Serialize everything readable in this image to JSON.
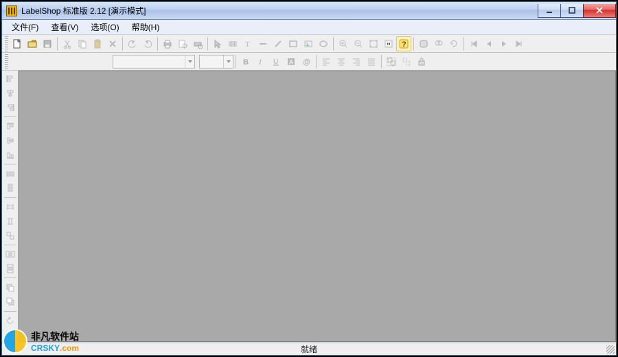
{
  "title": "LabelShop 标准版 2.12 [演示模式]",
  "menu": {
    "file": "文件(F)",
    "view": "查看(V)",
    "options": "选项(O)",
    "help": "帮助(H)"
  },
  "status": "就绪",
  "toolbar2": {
    "font_name": "",
    "font_size": ""
  },
  "watermark": {
    "line1": "非凡软件站",
    "line2_a": "CRSKY",
    "line2_b": ".com"
  },
  "icons": {
    "new": "new-file-icon",
    "open": "open-folder-icon",
    "save": "save-icon",
    "cut": "cut-icon",
    "copy": "copy-icon",
    "paste": "paste-icon",
    "delete": "delete-icon",
    "undo": "undo-icon",
    "redo": "redo-icon",
    "print": "print-icon",
    "preview": "print-preview-icon",
    "printset": "print-settings-icon",
    "pointer": "pointer-icon",
    "barcode": "barcode-icon",
    "text": "text-tool-icon",
    "line": "line-icon",
    "diag": "diag-line-icon",
    "rect": "rect-icon",
    "image": "image-icon",
    "ellipse": "ellipse-icon",
    "zoomin": "zoom-in-icon",
    "zoomout": "zoom-out-icon",
    "zoomfit": "zoom-fit-icon",
    "zoom100": "zoom-100-icon",
    "help": "help-icon",
    "db": "database-icon",
    "find": "find-icon",
    "refresh": "refresh-icon",
    "first": "first-record-icon",
    "prev": "prev-record-icon",
    "next": "next-record-icon",
    "last": "last-record-icon",
    "bold": "bold-icon",
    "italic": "italic-icon",
    "underline": "underline-icon",
    "fontcolor": "font-color-icon",
    "charmap": "charmap-icon",
    "alignL": "align-left-icon",
    "alignC": "align-center-icon",
    "alignR": "align-right-icon",
    "alignJ": "align-justify-icon",
    "group": "group-icon",
    "ungroup": "ungroup-icon",
    "lock": "lock-icon"
  },
  "side_icons": [
    "align-left-edge-icon",
    "align-center-h-icon",
    "align-right-edge-icon",
    "align-top-edge-icon",
    "align-center-v-icon",
    "align-bottom-edge-icon",
    "distribute-h-icon",
    "distribute-v-icon",
    "same-width-icon",
    "same-height-icon",
    "same-size-icon",
    "center-page-h-icon",
    "center-page-v-icon",
    "bring-front-icon",
    "send-back-icon",
    "rotate-left-icon",
    "rotate-right-icon",
    "flip-h-icon",
    "flip-v-icon"
  ]
}
